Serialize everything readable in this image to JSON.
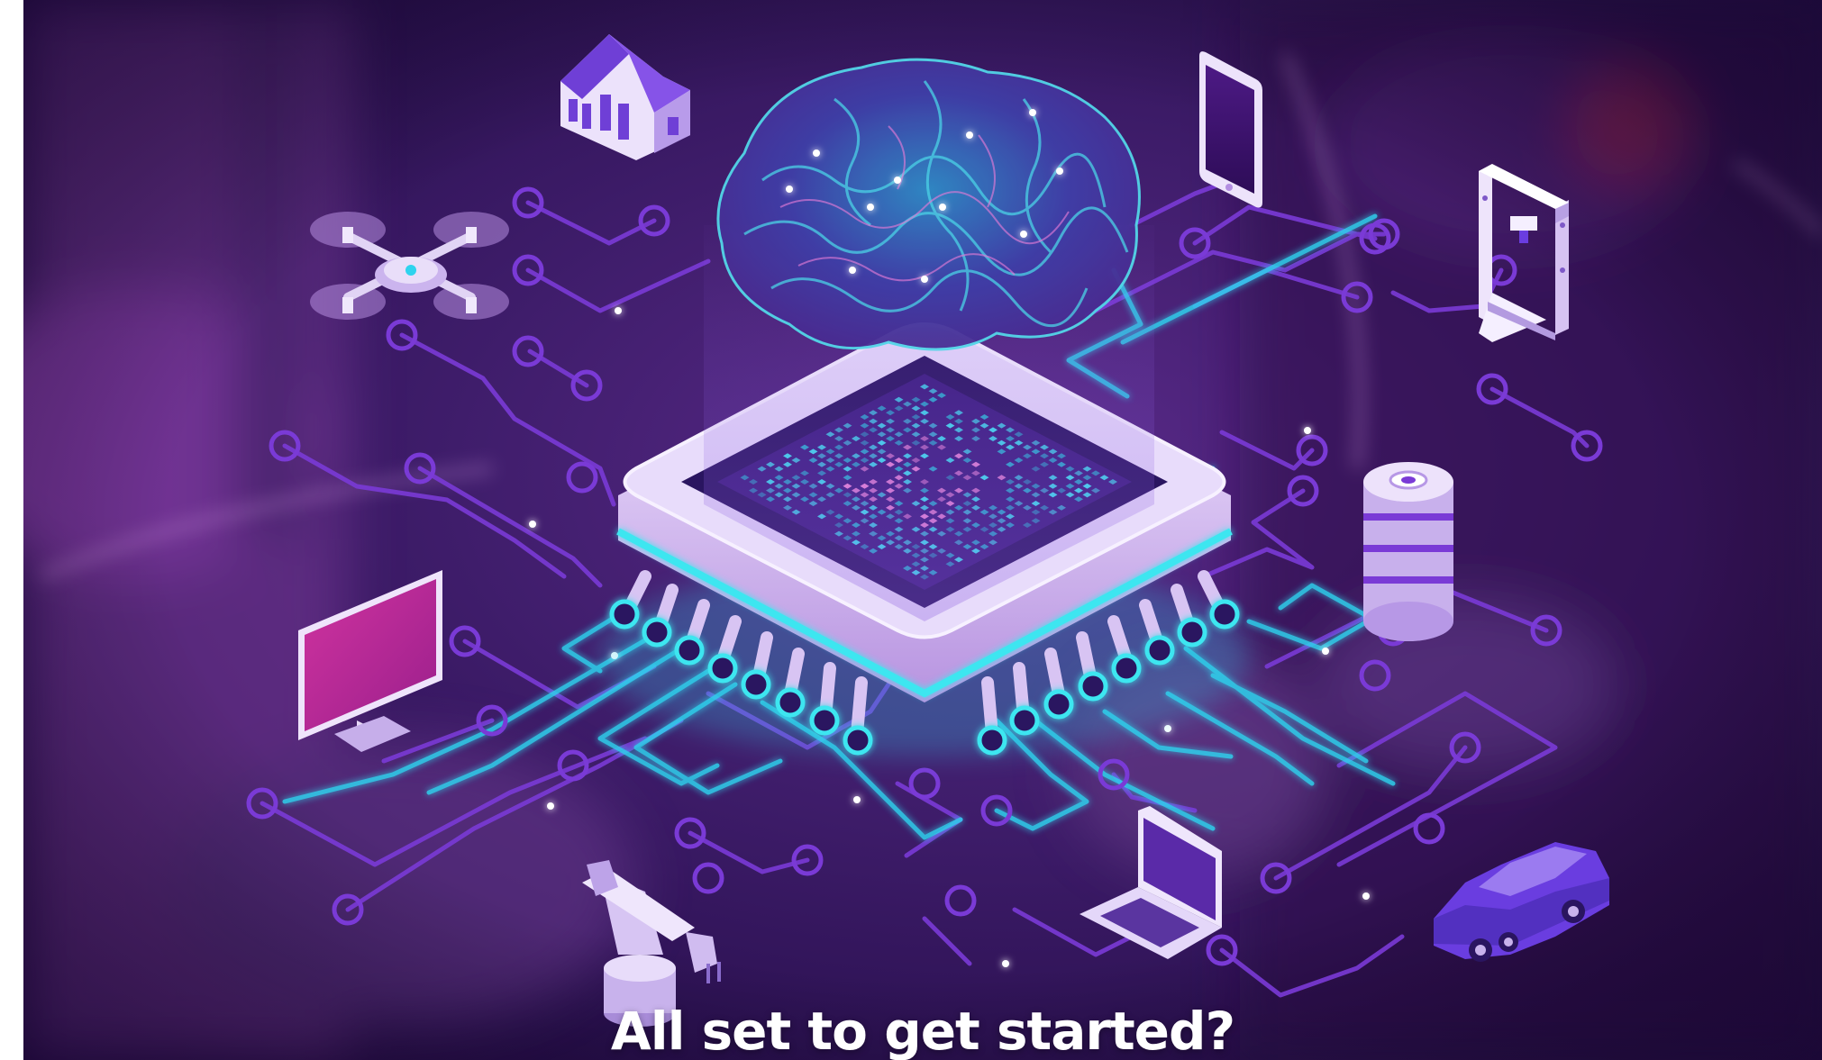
{
  "hero": {
    "cta_title": "All set to get started?"
  },
  "colors": {
    "background": "#3f1d6b",
    "circuit_line": "#7a3ad6",
    "circuit_glow": "#3ee6f0",
    "chip_top": "#e2d3f5",
    "chip_core": "#2a1560",
    "brain": "#3aa6d8",
    "monitor_screen": "#b3279c",
    "car": "#6a3de0",
    "cta_text": "#ffffff"
  },
  "icons": [
    "house-icon",
    "drone-icon",
    "smartphone-icon",
    "3d-printer-icon",
    "database-icon",
    "monitor-icon",
    "robot-arm-icon",
    "laptop-icon",
    "car-icon",
    "brain-icon",
    "processor-chip-icon"
  ]
}
